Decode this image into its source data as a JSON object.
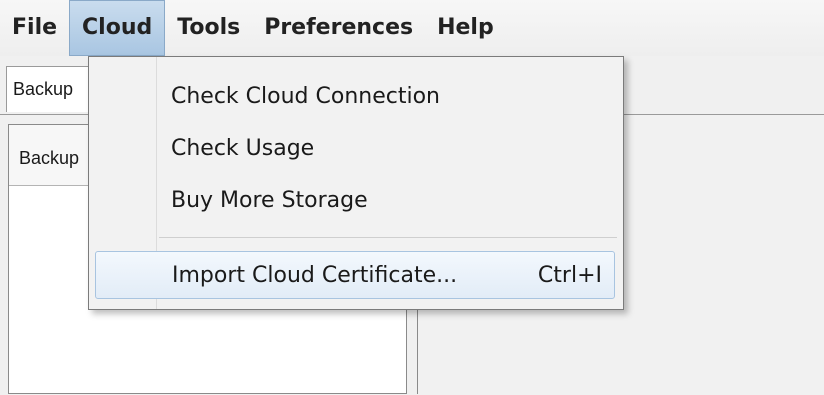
{
  "menubar": {
    "items": [
      "File",
      "Cloud",
      "Tools",
      "Preferences",
      "Help"
    ],
    "active": "Cloud"
  },
  "tabs": {
    "first_tab": "Backup"
  },
  "left_panel": {
    "header": "Backup"
  },
  "cloud_menu": {
    "items": [
      {
        "label": "Check Cloud Connection"
      },
      {
        "label": "Check Usage"
      },
      {
        "label": "Buy More Storage"
      },
      {
        "label": "Import Cloud Certificate...",
        "shortcut": "Ctrl+I"
      }
    ]
  },
  "colors": {
    "menu_active": "#b9d1ea",
    "item_highlight_border": "#a8c4e0",
    "background": "#f0f0f0"
  }
}
